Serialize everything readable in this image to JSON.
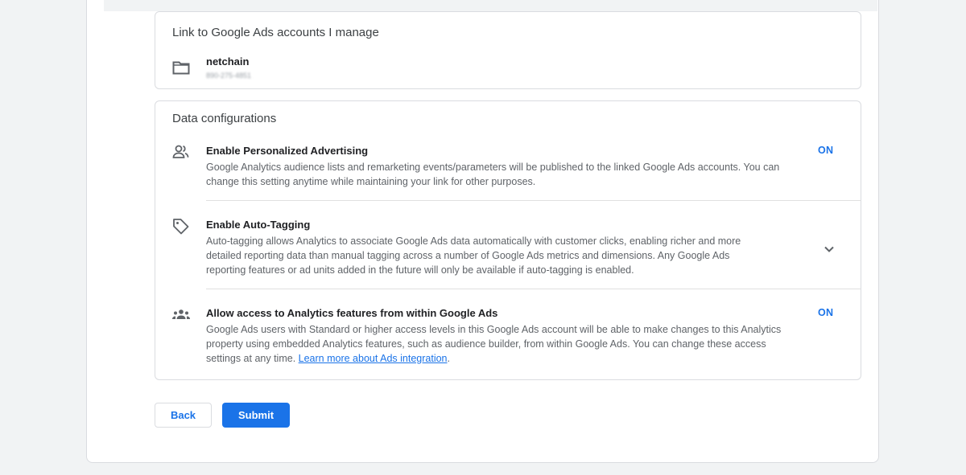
{
  "link_card": {
    "title": "Link to Google Ads accounts I manage",
    "account": {
      "name": "netchain",
      "id": "890-275-4851",
      "icon": "folder-icon"
    }
  },
  "data_config": {
    "title": "Data configurations",
    "rows": [
      {
        "icon": "person-icon",
        "title": "Enable Personalized Advertising",
        "desc": "Google Analytics audience lists and remarketing events/parameters will be published to the linked Google Ads accounts. You can change this setting anytime while maintaining your link for other purposes.",
        "state": "ON"
      },
      {
        "icon": "tag-icon",
        "title": "Enable Auto-Tagging",
        "desc": "Auto-tagging allows Analytics to associate Google Ads data automatically with customer clicks, enabling richer and more detailed reporting data than manual tagging across a number of Google Ads metrics and dimensions. Any Google Ads reporting features or ad units added in the future will only be available if auto-tagging is enabled.",
        "state_icon": "chevron-down-icon"
      },
      {
        "icon": "group-icon",
        "title": "Allow access to Analytics features from within Google Ads",
        "desc": "Google Ads users with Standard or higher access levels in this Google Ads account will be able to make changes to this Analytics property using embedded Analytics features, such as audience builder, from within Google Ads. You can change these access settings at any time.",
        "link": "Learn more about Ads integration",
        "state": "ON"
      }
    ]
  },
  "actions": {
    "back": "Back",
    "submit": "Submit"
  },
  "colors": {
    "accent": "#1a73e8",
    "border": "#dadce0",
    "text_secondary": "#5f6368"
  }
}
